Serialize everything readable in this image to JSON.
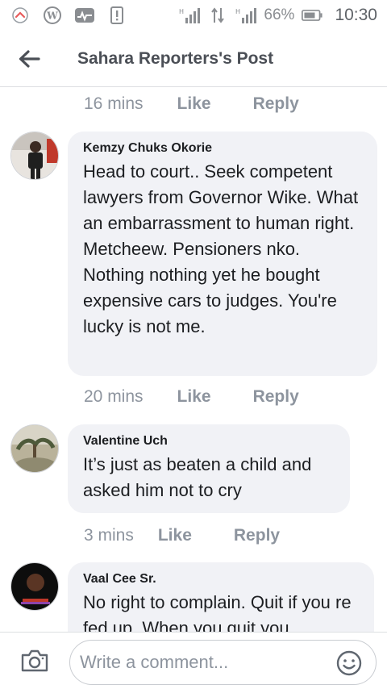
{
  "status_bar": {
    "battery": "66%",
    "time": "10:30",
    "icons": [
      "notification-icon",
      "wordpress-icon",
      "activity-icon",
      "sim-alert-icon",
      "signal-icon",
      "data-transfer-icon",
      "signal-icon",
      "battery-icon"
    ]
  },
  "header": {
    "title": "Sahara Reporters's Post",
    "back_icon": "arrow-left-icon"
  },
  "previous_meta": {
    "time": "16 mins",
    "like": "Like",
    "reply": "Reply"
  },
  "comments": [
    {
      "author": "Kemzy Chuks Okorie",
      "text": "Head to court.. Seek competent lawyers from Governor Wike. What an embarrassment to human right. Metcheew. Pensioners nko. Nothing nothing yet he bought expensive cars to judges. You're lucky is not me.",
      "time": "20 mins",
      "like": "Like",
      "reply": "Reply"
    },
    {
      "author": "Valentine Uch",
      "text": "It’s just as beaten a child and asked him not to cry",
      "time": "3 mins",
      "like": "Like",
      "reply": "Reply"
    },
    {
      "author": "Vaal Cee Sr.",
      "text": "No right to complain. Quit if you re fed up. When you quit you"
    }
  ],
  "composer": {
    "placeholder": "Write a comment...",
    "camera_icon": "camera-icon",
    "emoji_icon": "emoji-icon"
  },
  "colors": {
    "bubble": "#f1f2f6",
    "meta_text": "#8d949e",
    "header_text": "#4b4f56",
    "divider": "#dddfe2"
  }
}
